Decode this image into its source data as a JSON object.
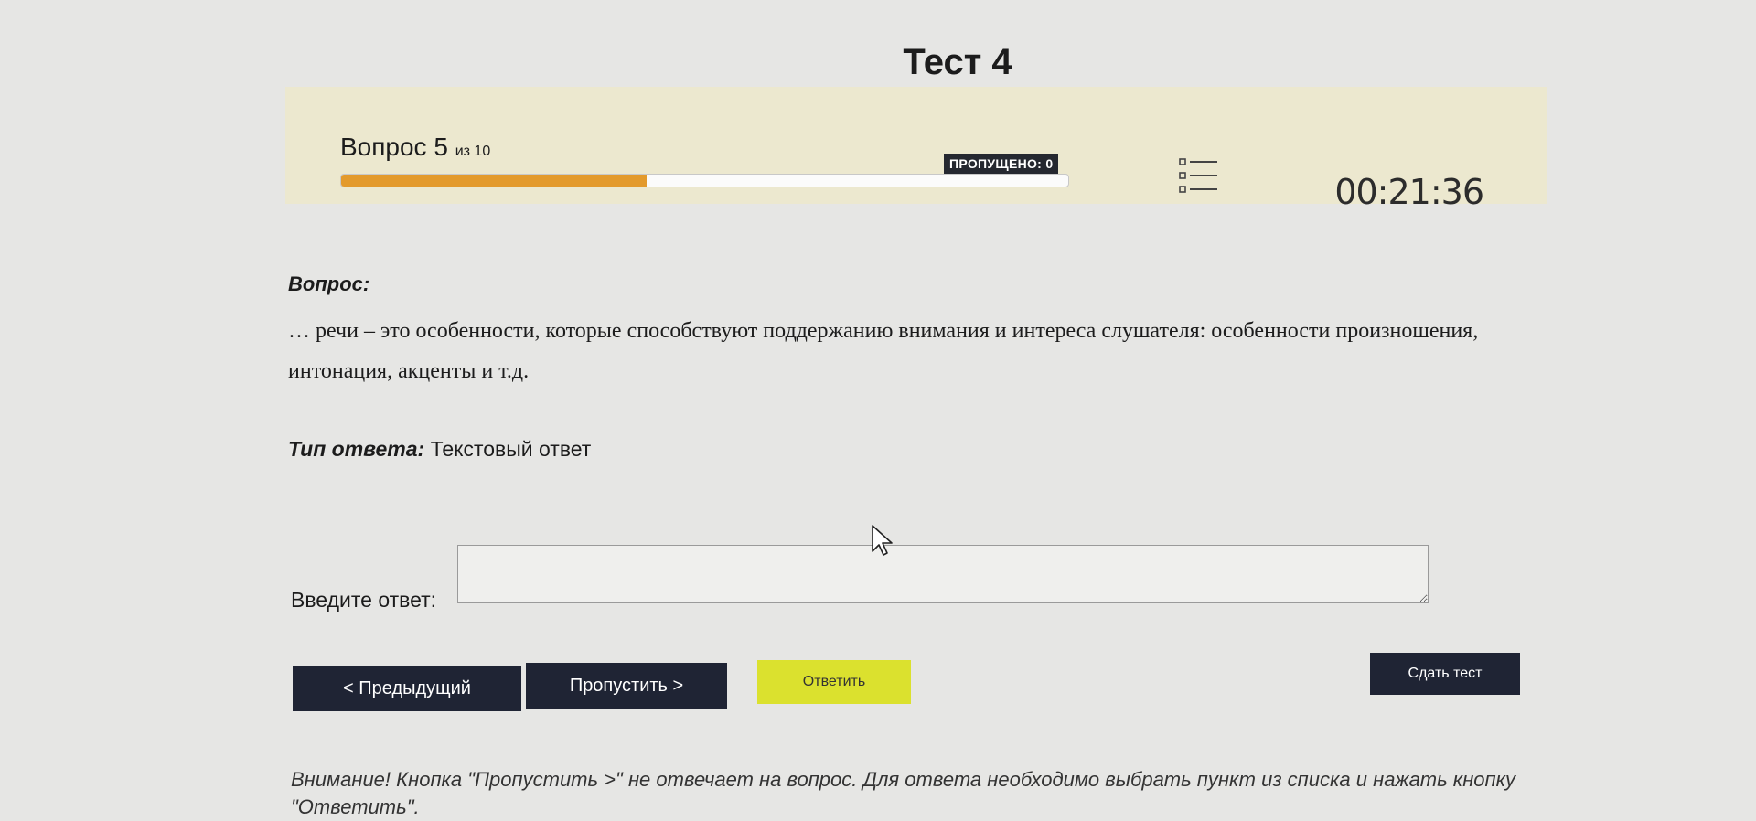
{
  "page": {
    "title": "Тест 4"
  },
  "status": {
    "question_word": "Вопрос",
    "question_number": "5",
    "of_text": "из 10",
    "progress_fraction": 0.42,
    "skipped_label": "ПРОПУЩЕНО: 0",
    "list_icon": "list-icon",
    "timer": "00:21:36"
  },
  "question": {
    "label": "Вопрос:",
    "text": "… речи – это особенности, которые способствуют поддержанию внимания и интереса слушателя: особенности произношения, интонация, акценты и т.д."
  },
  "answer_type": {
    "label": "Тип ответа:",
    "value": "Текстовый ответ"
  },
  "answer": {
    "label": "Введите ответ:",
    "value": ""
  },
  "buttons": {
    "prev": "< Предыдущий",
    "skip": "Пропустить >",
    "answer": "Ответить",
    "finish": "Сдать тест"
  },
  "notice": "Внимание! Кнопка \"Пропустить >\" не отвечает на вопрос. Для ответа необходимо выбрать пункт из списка и нажать кнопку \"Ответить\".",
  "colors": {
    "status_bar_bg": "#ece8cf",
    "progress_fill": "#e39a2c",
    "dark_button": "#1f2434",
    "answer_button": "#dbe12e"
  }
}
